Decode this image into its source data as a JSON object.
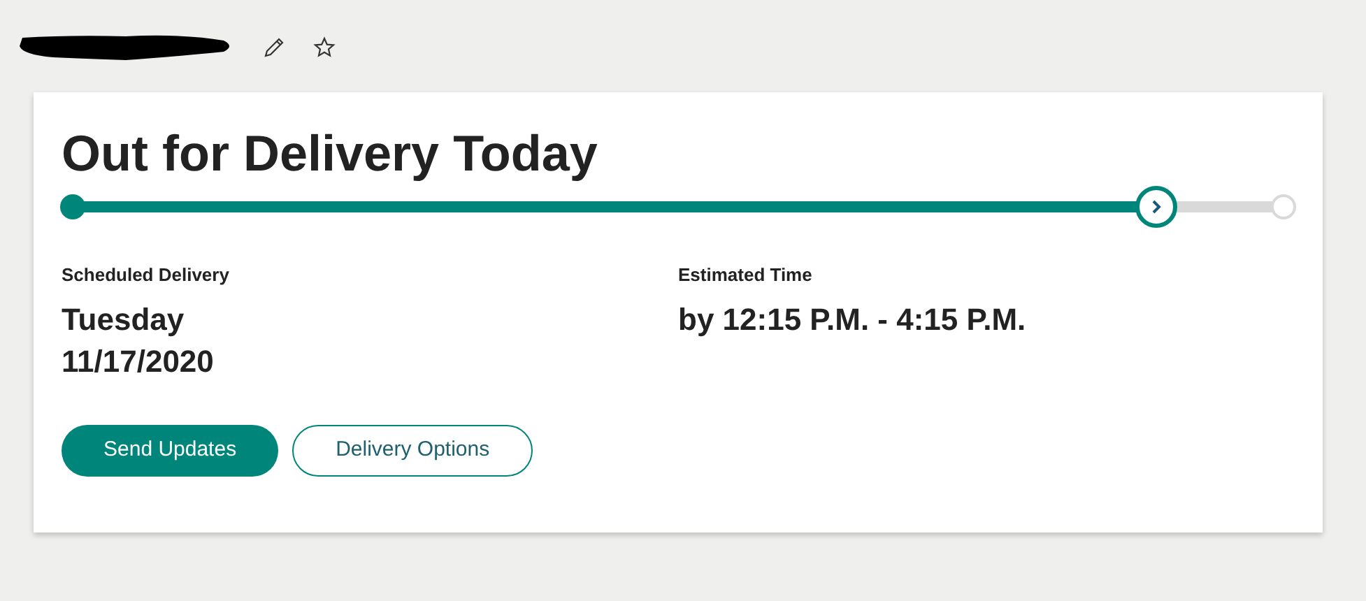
{
  "header": {
    "redacted": true
  },
  "status": {
    "title": "Out for Delivery Today",
    "level": 0.895
  },
  "details": [
    {
      "label": "Scheduled Delivery",
      "value": "Tuesday\n11/17/2020"
    },
    {
      "label": "Estimated Time",
      "value": "by 12:15 P.M. - 4:15 P.M."
    }
  ],
  "buttons": [
    {
      "label": "Send Updates",
      "kind": "primary"
    },
    {
      "label": "Delivery Options",
      "kind": "outline"
    }
  ]
}
